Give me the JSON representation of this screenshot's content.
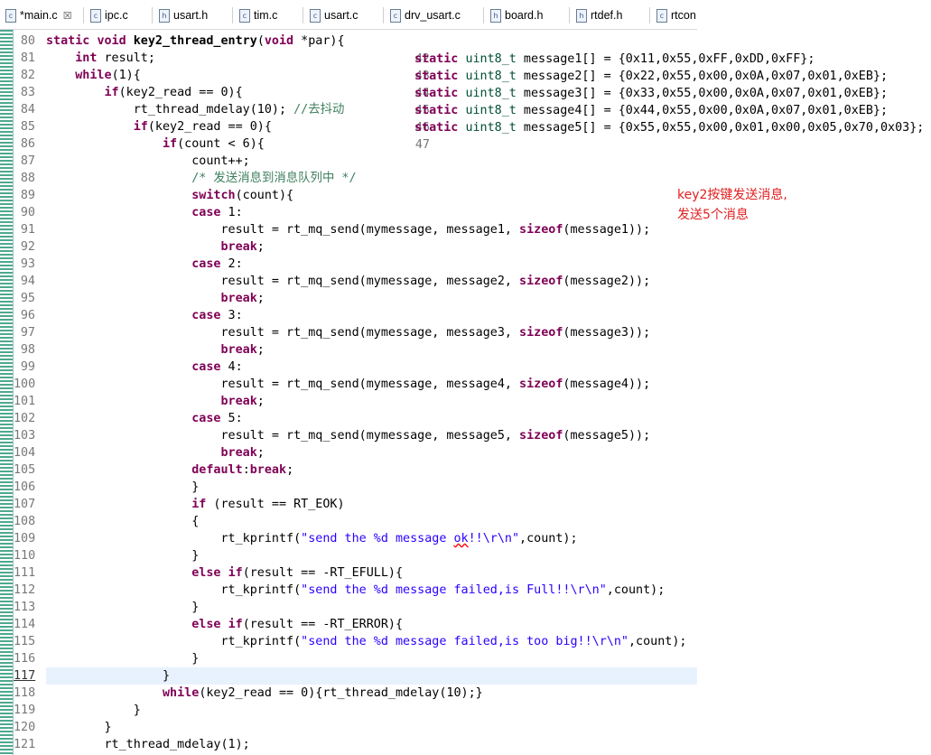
{
  "tabs": [
    {
      "label": "*main.c",
      "closable": true,
      "active": true
    },
    {
      "label": "ipc.c"
    },
    {
      "label": "usart.h"
    },
    {
      "label": "tim.c"
    },
    {
      "label": "usart.c"
    },
    {
      "label": "drv_usart.c"
    },
    {
      "label": "board.h"
    },
    {
      "label": "rtdef.h"
    },
    {
      "label": "rtcon"
    }
  ],
  "editor": {
    "current_line": "117",
    "lines": [
      {
        "n": "80",
        "text": "static void key2_thread_entry(void *par){"
      },
      {
        "n": "81",
        "text": "    int result;"
      },
      {
        "n": "82",
        "text": "    while(1){"
      },
      {
        "n": "83",
        "text": "        if(key2_read == 0){"
      },
      {
        "n": "84",
        "text": "            rt_thread_mdelay(10); //去抖动"
      },
      {
        "n": "85",
        "text": "            if(key2_read == 0){"
      },
      {
        "n": "86",
        "text": "                if(count < 6){"
      },
      {
        "n": "87",
        "text": "                    count++;"
      },
      {
        "n": "88",
        "text": "                    /* 发送消息到消息队列中 */"
      },
      {
        "n": "89",
        "text": "                    switch(count){"
      },
      {
        "n": "90",
        "text": "                    case 1:"
      },
      {
        "n": "91",
        "text": "                        result = rt_mq_send(mymessage, message1, sizeof(message1));"
      },
      {
        "n": "92",
        "text": "                        break;"
      },
      {
        "n": "93",
        "text": "                    case 2:"
      },
      {
        "n": "94",
        "text": "                        result = rt_mq_send(mymessage, message2, sizeof(message2));"
      },
      {
        "n": "95",
        "text": "                        break;"
      },
      {
        "n": "96",
        "text": "                    case 3:"
      },
      {
        "n": "97",
        "text": "                        result = rt_mq_send(mymessage, message3, sizeof(message3));"
      },
      {
        "n": "98",
        "text": "                        break;"
      },
      {
        "n": "99",
        "text": "                    case 4:"
      },
      {
        "n": "100",
        "text": "                        result = rt_mq_send(mymessage, message4, sizeof(message4));"
      },
      {
        "n": "101",
        "text": "                        break;"
      },
      {
        "n": "102",
        "text": "                    case 5:"
      },
      {
        "n": "103",
        "text": "                        result = rt_mq_send(mymessage, message5, sizeof(message5));"
      },
      {
        "n": "104",
        "text": "                        break;"
      },
      {
        "n": "105",
        "text": "                    default:break;"
      },
      {
        "n": "106",
        "text": "                    }"
      },
      {
        "n": "107",
        "text": "                    if (result == RT_EOK)"
      },
      {
        "n": "108",
        "text": "                    {"
      },
      {
        "n": "109",
        "text": "                        rt_kprintf(\"send the %d message ok!!\\r\\n\",count);"
      },
      {
        "n": "110",
        "text": "                    }"
      },
      {
        "n": "111",
        "text": "                    else if(result == -RT_EFULL){"
      },
      {
        "n": "112",
        "text": "                        rt_kprintf(\"send the %d message failed,is Full!!\\r\\n\",count);"
      },
      {
        "n": "113",
        "text": "                    }"
      },
      {
        "n": "114",
        "text": "                    else if(result == -RT_ERROR){"
      },
      {
        "n": "115",
        "text": "                        rt_kprintf(\"send the %d message failed,is too big!!\\r\\n\",count);"
      },
      {
        "n": "116",
        "text": "                    }"
      },
      {
        "n": "117",
        "text": "                }"
      },
      {
        "n": "118",
        "text": "                while(key2_read == 0){rt_thread_mdelay(10);}"
      },
      {
        "n": "119",
        "text": "            }"
      },
      {
        "n": "120",
        "text": "        }"
      },
      {
        "n": "121",
        "text": "        rt_thread_mdelay(1);"
      }
    ]
  },
  "overlay": {
    "lines": [
      {
        "n": "42",
        "text": "static uint8_t message1[] = {0x11,0x55,0xFF,0xDD,0xFF};"
      },
      {
        "n": "43",
        "text": "static uint8_t message2[] = {0x22,0x55,0x00,0x0A,0x07,0x01,0xEB};"
      },
      {
        "n": "44",
        "text": "static uint8_t message3[] = {0x33,0x55,0x00,0x0A,0x07,0x01,0xEB};"
      },
      {
        "n": "45",
        "text": "static uint8_t message4[] = {0x44,0x55,0x00,0x0A,0x07,0x01,0xEB};"
      },
      {
        "n": "46",
        "text": "static uint8_t message5[] = {0x55,0x55,0x00,0x01,0x00,0x05,0x70,0x03};"
      },
      {
        "n": "47",
        "text": ""
      }
    ]
  },
  "annotation": {
    "line1": "key2按键发送消息,",
    "line2": "发送5个消息"
  },
  "colors": {
    "keyword": "#7f0055",
    "string": "#2a00ff",
    "comment": "#3f7f5f",
    "annotation": "#e02020"
  }
}
